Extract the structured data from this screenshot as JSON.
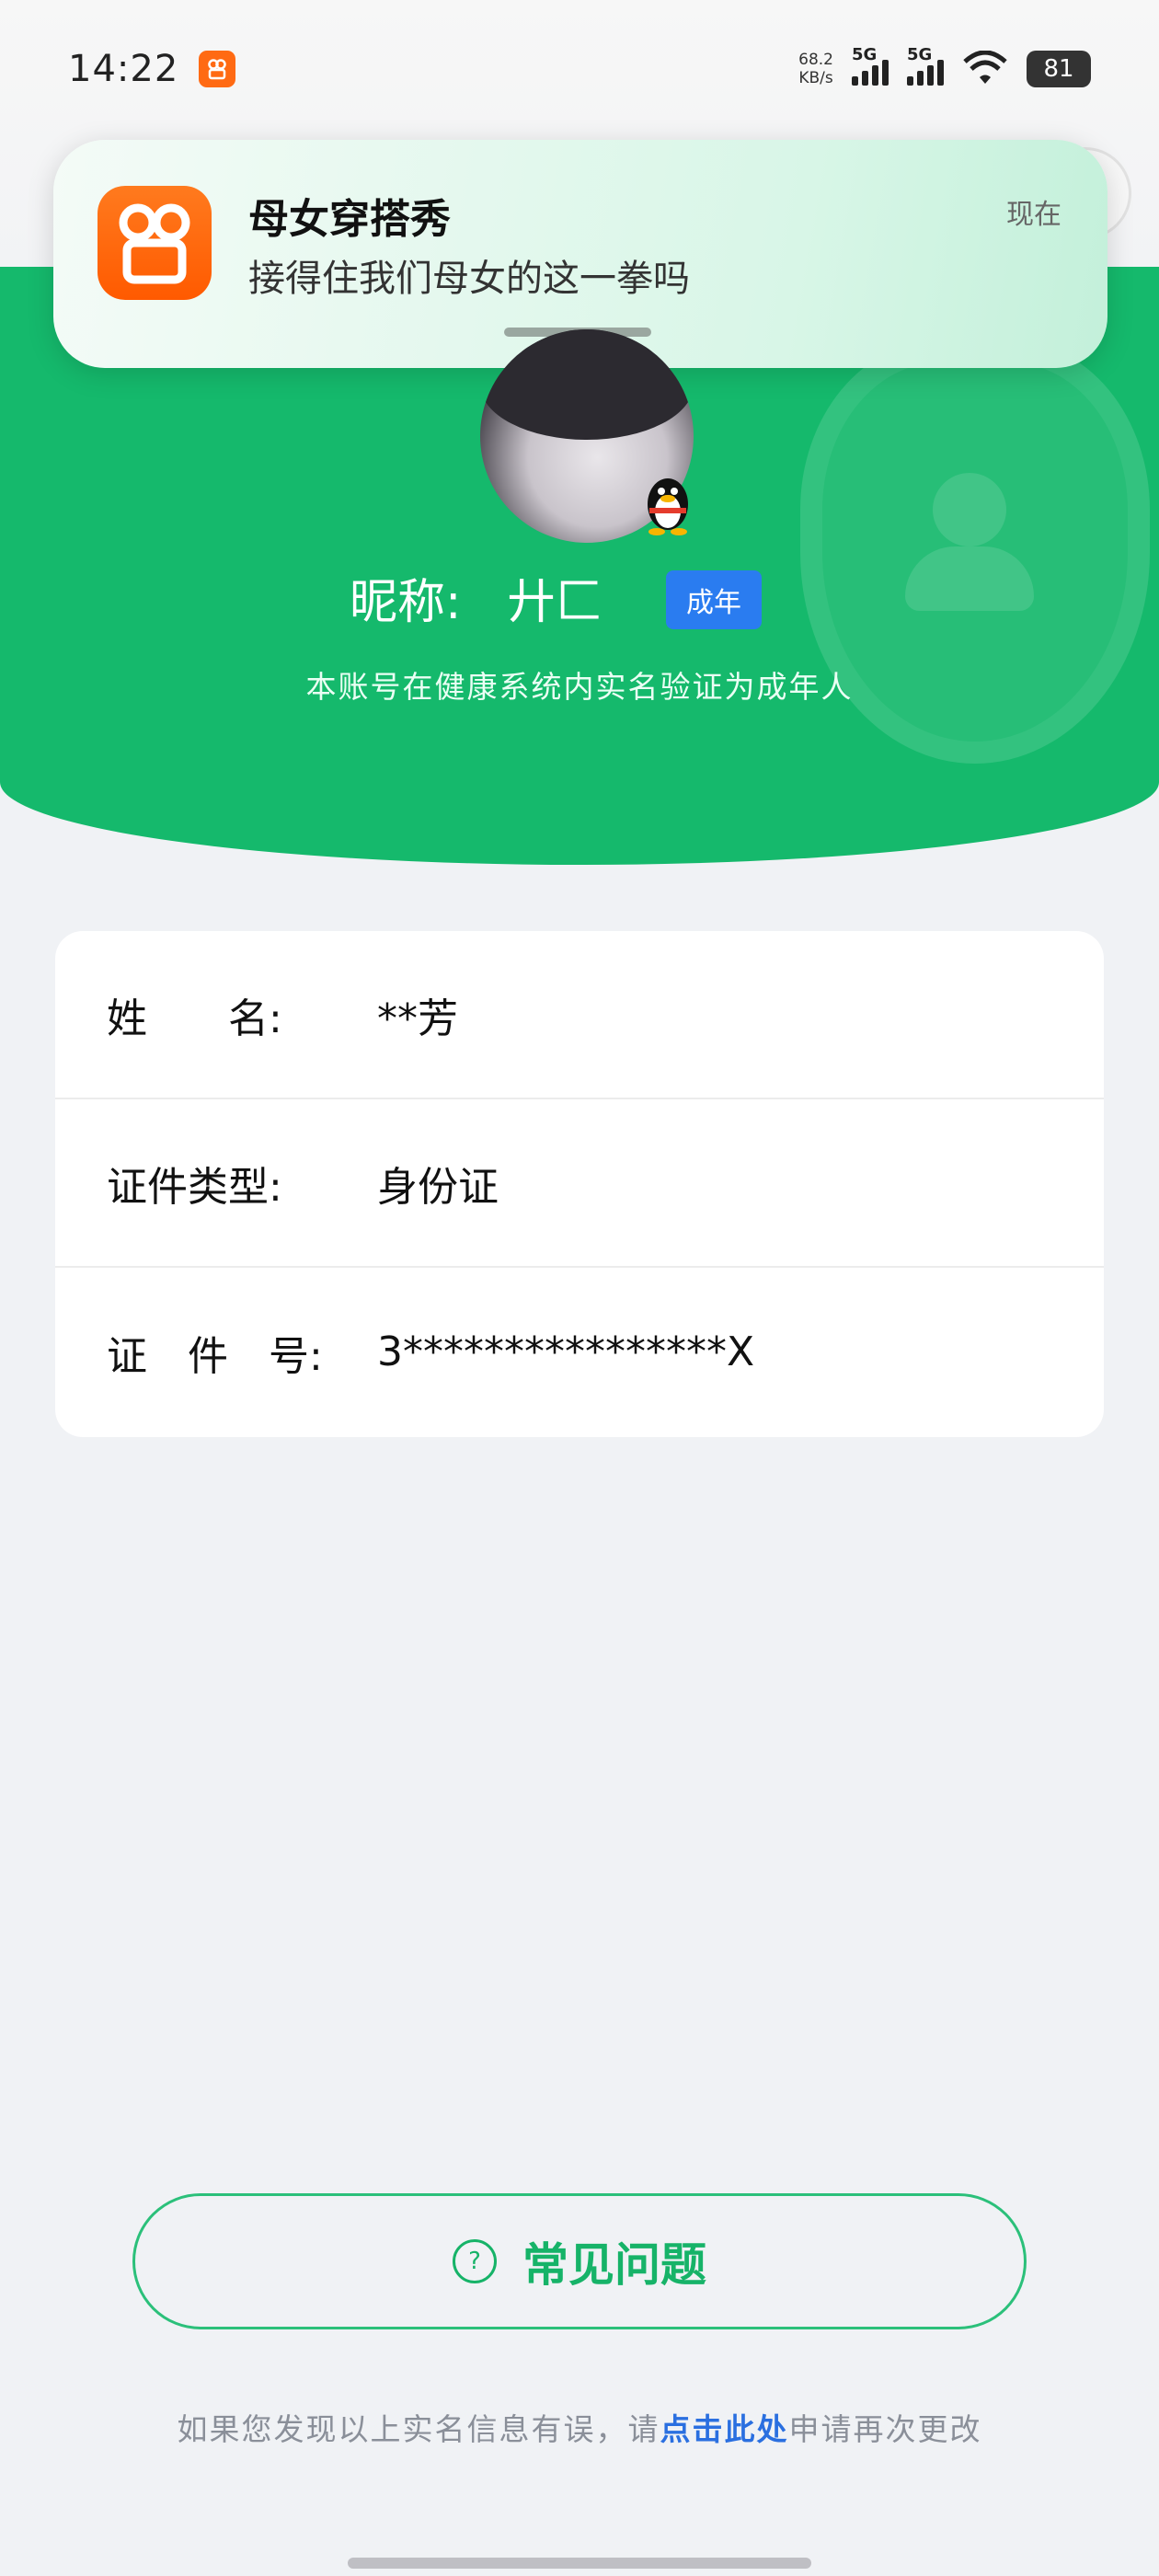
{
  "status_bar": {
    "time": "14:22",
    "speed_value": "68.2",
    "speed_unit": "KB/s",
    "signal1": "5G",
    "signal2": "5G",
    "battery": "81"
  },
  "notification": {
    "title": "母女穿搭秀",
    "body": "接得住我们母女的这一拳吗",
    "time": "现在",
    "app_icon": "kuaishou-icon",
    "app_color": "#ff6a13"
  },
  "profile": {
    "nick_label": "昵称:",
    "nick_value": "廾匚",
    "age_tag": "成年",
    "verified_text": "本账号在健康系统内实名验证为成年人",
    "badge_icon": "qq-penguin-icon"
  },
  "info": {
    "rows": [
      {
        "label": "姓　　名:",
        "value": "**芳"
      },
      {
        "label": "证件类型:",
        "value": "身份证"
      },
      {
        "label": "证　件　号:",
        "value": "3****************X"
      }
    ]
  },
  "faq": {
    "label": "常见问题",
    "icon": "question-circle-icon"
  },
  "footer": {
    "prefix": "如果您发现以上实名信息有误，请",
    "link": "点击此处",
    "suffix": "申请再次更改"
  },
  "colors": {
    "primary_green": "#15b96c",
    "tag_blue": "#2a7cf0",
    "link_blue": "#2a6fe0"
  }
}
